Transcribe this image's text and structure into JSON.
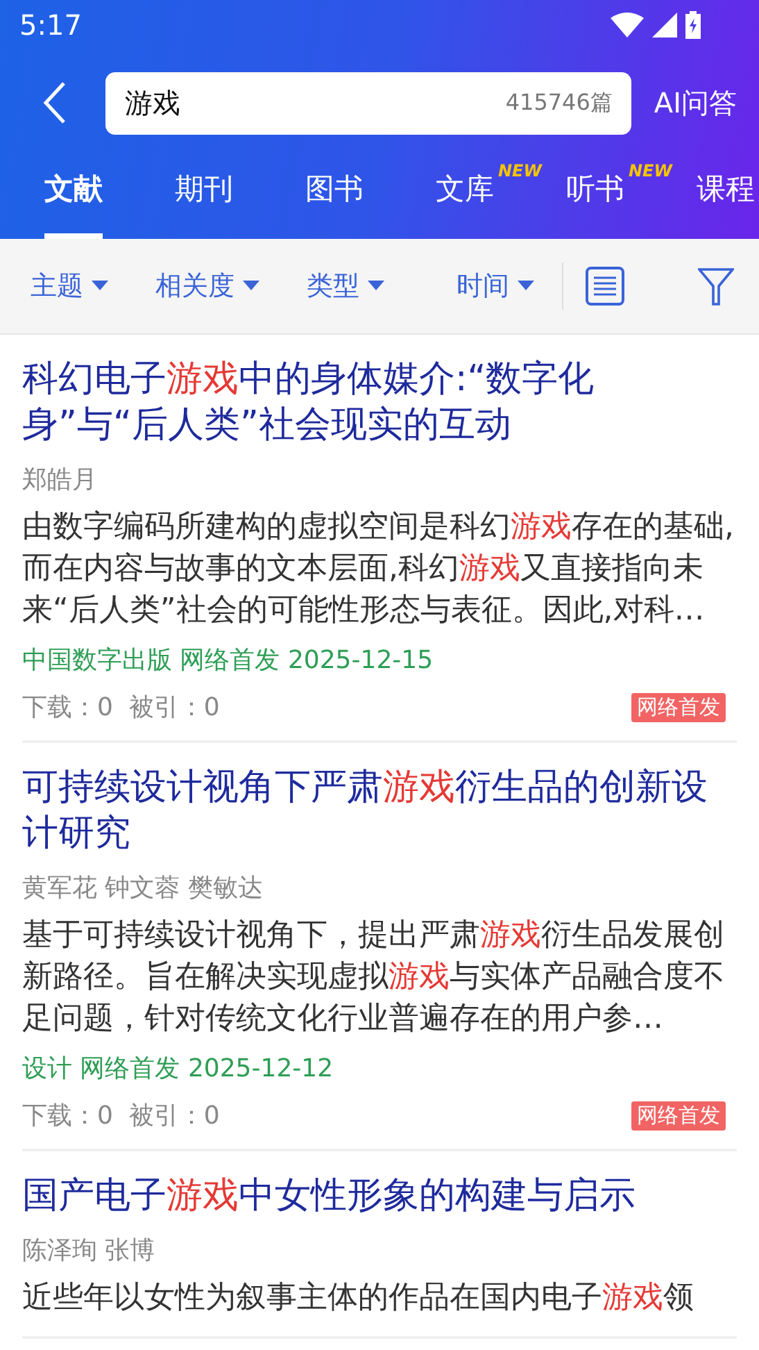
{
  "status_bar": {
    "time": "5:17"
  },
  "search": {
    "value": "游戏",
    "count": "415746篇",
    "ai_button": "AI问答"
  },
  "tabs": [
    {
      "label": "文献",
      "selected": true
    },
    {
      "label": "期刊",
      "selected": false
    },
    {
      "label": "图书",
      "selected": false
    },
    {
      "label": "文库",
      "selected": false,
      "badge": "NEW"
    },
    {
      "label": "听书",
      "selected": false,
      "badge": "NEW"
    },
    {
      "label": "课程",
      "selected": false
    }
  ],
  "filters": [
    {
      "label": "主题"
    },
    {
      "label": "相关度"
    },
    {
      "label": "类型"
    },
    {
      "label": "时间"
    }
  ],
  "results": [
    {
      "title": [
        {
          "text": "科幻电子",
          "highlight": false
        },
        {
          "text": "游戏",
          "highlight": true
        },
        {
          "text": "中的身体媒介:“数字化身”与“后人类”社会现实的互动",
          "highlight": false
        }
      ],
      "authors": "郑皓月",
      "abstract": [
        {
          "text": "由数字编码所建构的虚拟空间是科幻",
          "highlight": false
        },
        {
          "text": "游戏",
          "highlight": true
        },
        {
          "text": "存在的基础,而在内容与故事的文本层面,科幻",
          "highlight": false
        },
        {
          "text": "游戏",
          "highlight": true
        },
        {
          "text": "又直接指向未来“后人类”社会的可能性形态与表征。因此,对科…",
          "highlight": false
        }
      ],
      "source": "中国数字出版 网络首发 2025-12-15",
      "stats": "下载：0  被引：0",
      "badge": "网络首发"
    },
    {
      "title": [
        {
          "text": "可持续设计视角下严肃",
          "highlight": false
        },
        {
          "text": "游戏",
          "highlight": true
        },
        {
          "text": "衍生品的创新设计研究",
          "highlight": false
        }
      ],
      "authors": "黄军花 钟文蓉 樊敏达",
      "abstract": [
        {
          "text": "基于可持续设计视角下，提出严肃",
          "highlight": false
        },
        {
          "text": "游戏",
          "highlight": true
        },
        {
          "text": "衍生品发展创新路径。旨在解决实现虚拟",
          "highlight": false
        },
        {
          "text": "游戏",
          "highlight": true
        },
        {
          "text": "与实体产品融合度不足问题，针对传统文化行业普遍存在的用户参…",
          "highlight": false
        }
      ],
      "source": "设计 网络首发 2025-12-12",
      "stats": "下载：0  被引：0",
      "badge": "网络首发"
    },
    {
      "title": [
        {
          "text": "国产电子",
          "highlight": false
        },
        {
          "text": "游戏",
          "highlight": true
        },
        {
          "text": "中女性形象的构建与启示",
          "highlight": false
        }
      ],
      "authors": "陈泽珣 张博",
      "abstract": [
        {
          "text": "近些年以女性为叙事主体的作品在国内电子",
          "highlight": false
        },
        {
          "text": "游戏",
          "highlight": true
        },
        {
          "text": "领",
          "highlight": false
        }
      ]
    }
  ]
}
